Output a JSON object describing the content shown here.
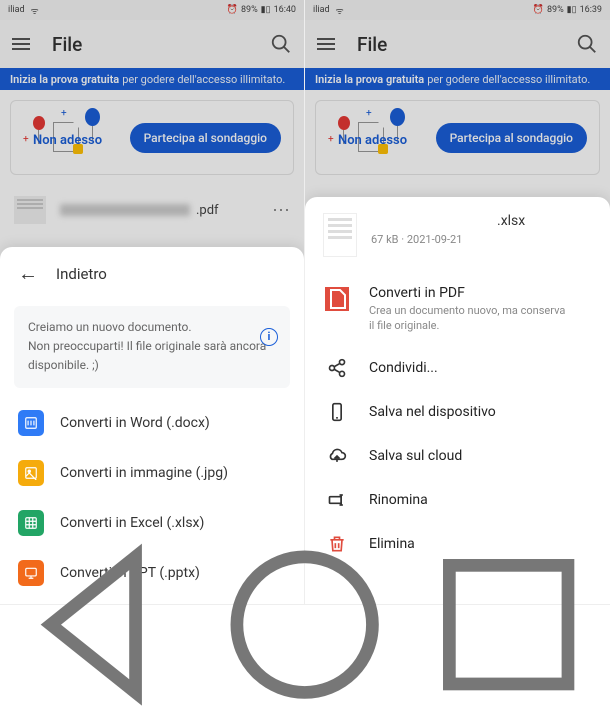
{
  "left": {
    "statusbar": {
      "carrier": "iliad",
      "battery": "89%",
      "time": "16:40"
    },
    "topbar": {
      "title": "File"
    },
    "banner": {
      "strong": "Inizia la prova gratuita",
      "rest": "per godere dell'accesso illimitato."
    },
    "promo": {
      "try_now": "Non adesso",
      "survey": "Partecipa al sondaggio"
    },
    "file_ext": ".pdf",
    "sheet": {
      "back": "Indietro",
      "info_line1": "Creiamo un nuovo documento.",
      "info_line2": "Non preoccuparti! Il file originale sarà ancora disponibile. ;)",
      "options": {
        "word": "Converti in Word (.docx)",
        "image": "Converti in immagine (.jpg)",
        "excel": "Converti in Excel (.xlsx)",
        "ppt": "Converti in PPT (.pptx)"
      }
    }
  },
  "right": {
    "statusbar": {
      "carrier": "iliad",
      "battery": "89%",
      "time": "16:39"
    },
    "topbar": {
      "title": "File"
    },
    "banner": {
      "strong": "Inizia la prova gratuita",
      "rest": "per godere dell'accesso illimitato."
    },
    "promo": {
      "try_now": "Non adesso",
      "survey": "Partecipa al sondaggio"
    },
    "sheet": {
      "file_ext": ".xlsx",
      "file_meta": "67 kB · 2021-09-21",
      "convert_pdf": {
        "title": "Converti in PDF",
        "sub": "Crea un documento nuovo, ma conserva il file originale."
      },
      "share": "Condividi...",
      "save_device": "Salva nel dispositivo",
      "save_cloud": "Salva sul cloud",
      "rename": "Rinomina",
      "delete": "Elimina"
    }
  }
}
